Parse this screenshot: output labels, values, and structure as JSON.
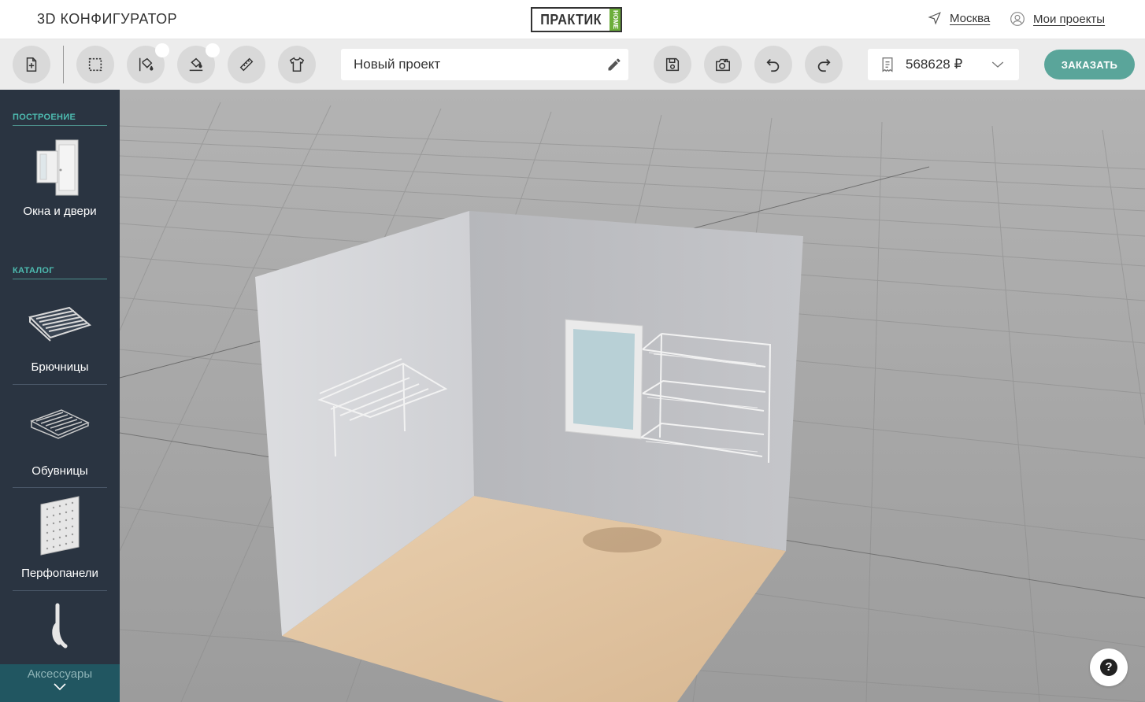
{
  "header": {
    "app_title": "3D КОНФИГУРАТОР",
    "logo_text": "ПРАКТИК",
    "logo_sub": "HOME",
    "city": "Москва",
    "my_projects": "Мои проекты"
  },
  "toolbar": {
    "buttons": [
      {
        "name": "new-project-icon"
      },
      {
        "name": "select-area-icon"
      },
      {
        "name": "paint-wall-icon"
      },
      {
        "name": "paint-floor-icon"
      },
      {
        "name": "measure-icon"
      },
      {
        "name": "wardrobe-items-icon"
      }
    ],
    "project_name": "Новый проект",
    "price": "568628 ₽",
    "order_label": "ЗАКАЗАТЬ"
  },
  "sidebar": {
    "section_build": "ПОСТРОЕНИЕ",
    "section_catalog": "КАТАЛОГ",
    "items": [
      {
        "label": "Окна и двери"
      },
      {
        "label": "Брючницы"
      },
      {
        "label": "Обувницы"
      },
      {
        "label": "Перфопанели"
      },
      {
        "label": "Аксессуары"
      }
    ]
  },
  "help": {
    "label": "?"
  },
  "colors": {
    "accent": "#5aa59a",
    "sidebar_bg": "#2a3441",
    "section_label": "#4dbbb0",
    "logo_green": "#6cae3b"
  }
}
